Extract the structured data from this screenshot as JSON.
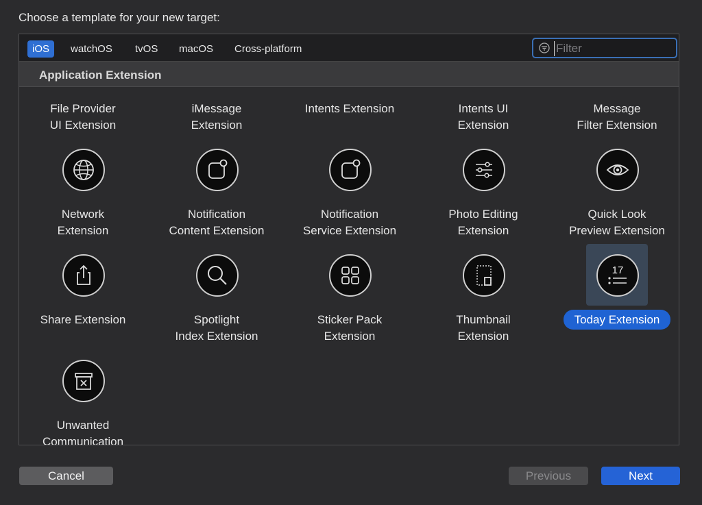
{
  "dialog": {
    "title": "Choose a template for your new target:"
  },
  "tabs": [
    {
      "label": "iOS",
      "active": true
    },
    {
      "label": "watchOS",
      "active": false
    },
    {
      "label": "tvOS",
      "active": false
    },
    {
      "label": "macOS",
      "active": false
    },
    {
      "label": "Cross-platform",
      "active": false
    }
  ],
  "filter": {
    "placeholder": "Filter",
    "value": ""
  },
  "section": {
    "title": "Application Extension"
  },
  "templates": [
    {
      "label": "File Provider\nUI Extension",
      "icon": "none"
    },
    {
      "label": "iMessage\nExtension",
      "icon": "none"
    },
    {
      "label": "Intents Extension",
      "icon": "none"
    },
    {
      "label": "Intents UI\nExtension",
      "icon": "none"
    },
    {
      "label": "Message\nFilter Extension",
      "icon": "none"
    },
    {
      "label": "Network\nExtension",
      "icon": "globe-icon"
    },
    {
      "label": "Notification\nContent Extension",
      "icon": "notification-icon"
    },
    {
      "label": "Notification\nService Extension",
      "icon": "notification-icon"
    },
    {
      "label": "Photo Editing\nExtension",
      "icon": "sliders-icon"
    },
    {
      "label": "Quick Look\nPreview Extension",
      "icon": "eye-icon"
    },
    {
      "label": "Share Extension",
      "icon": "share-icon"
    },
    {
      "label": "Spotlight\nIndex Extension",
      "icon": "magnifier-icon"
    },
    {
      "label": "Sticker Pack\nExtension",
      "icon": "grid-icon"
    },
    {
      "label": "Thumbnail\nExtension",
      "icon": "thumbnail-icon"
    },
    {
      "label": "Today Extension",
      "icon": "calendar-icon",
      "selected": true,
      "icon_text": "17"
    },
    {
      "label": "Unwanted\nCommunication",
      "icon": "junk-box-icon"
    }
  ],
  "buttons": {
    "cancel": "Cancel",
    "previous": "Previous",
    "next": "Next"
  },
  "colors": {
    "accent": "#2563d6",
    "selection_bg": "#3a4757",
    "background": "#2b2b2d"
  }
}
